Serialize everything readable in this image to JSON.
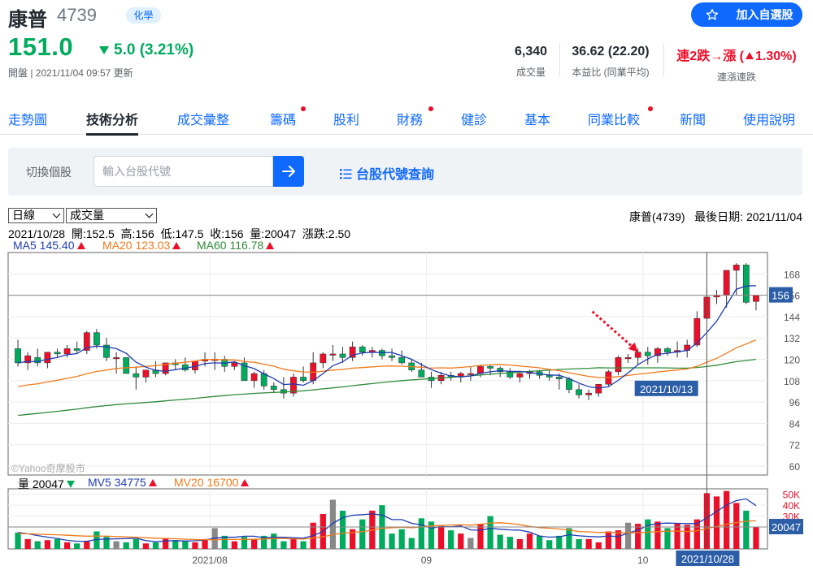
{
  "header": {
    "name": "康普",
    "code": "4739",
    "industry": "化學",
    "watch_label": "加入自選股",
    "price": "151.0",
    "change": "5.0 (3.21%)",
    "market_time": "開盤 | 2021/11/04 09:57 更新",
    "stats": {
      "volume_value": "6,340",
      "volume_label": "成交量",
      "pe_value": "36.62 (22.20)",
      "pe_label": "本益比 (同業平均)",
      "streak_value_pre": "連2跌→漲 (",
      "streak_value_pct": "1.30%)",
      "streak_label": "連漲連跌"
    },
    "colors": {
      "up": "#eb0f29",
      "down": "#00ab5e",
      "accent": "#0f69ff"
    }
  },
  "tabs": [
    {
      "label": "走勢圖",
      "active": false,
      "dot": false
    },
    {
      "label": "技術分析",
      "active": true,
      "dot": false
    },
    {
      "label": "成交彙整",
      "active": false,
      "dot": false
    },
    {
      "label": "籌碼",
      "active": false,
      "dot": true
    },
    {
      "label": "股利",
      "active": false,
      "dot": false
    },
    {
      "label": "財務",
      "active": false,
      "dot": true
    },
    {
      "label": "健診",
      "active": false,
      "dot": false
    },
    {
      "label": "基本",
      "active": false,
      "dot": false
    },
    {
      "label": "同業比較",
      "active": false,
      "dot": true
    },
    {
      "label": "新聞",
      "active": false,
      "dot": false
    },
    {
      "label": "使用說明",
      "active": false,
      "dot": false
    }
  ],
  "switch": {
    "label": "切換個股",
    "placeholder": "輸入台股代號",
    "lookup": "台股代號查詢"
  },
  "controls": {
    "period": "日線",
    "indicator": "成交量",
    "meta": "康普(4739)   最後日期: 2021/11/04",
    "ohlc": "2021/10/28  開:152.5  高:156  低:147.5  收:156  量:20047  漲跌:2.50",
    "ma5": "MA5 145.40",
    "ma20": "MA20 123.03",
    "ma60": "MA60 116.78",
    "vol": "量 20047",
    "mv5": "MV5 34775",
    "mv20": "MV20 16700"
  },
  "chart_data": {
    "type": "candlestick",
    "price_ticks": [
      "168",
      "156",
      "144",
      "132",
      "120",
      "108",
      "96",
      "84",
      "72",
      "60"
    ],
    "volume_ticks": [
      "50K",
      "40K",
      "30K",
      "20K"
    ],
    "x_labels": [
      "2021/08",
      "09",
      "10"
    ],
    "current_price_label": "156",
    "current_volume_label": "20047",
    "annotation_date": "2021/10/13",
    "crosshair_date": "2021/10/28",
    "watermark": "©Yahoo奇摩股市",
    "ylim": [
      55,
      180
    ],
    "vol_ylim": [
      0,
      55000
    ],
    "candles": [
      [
        126,
        131,
        116,
        118
      ],
      [
        118,
        124,
        114,
        122
      ],
      [
        121,
        126,
        116,
        118
      ],
      [
        118,
        124,
        115,
        124
      ],
      [
        124,
        126,
        121,
        123
      ],
      [
        123,
        128,
        121,
        126
      ],
      [
        126,
        130,
        123,
        125
      ],
      [
        125,
        136,
        123,
        135
      ],
      [
        135,
        137,
        126,
        128
      ],
      [
        128,
        132,
        119,
        121
      ],
      [
        121,
        124,
        112,
        121
      ],
      [
        121,
        121,
        114,
        112
      ],
      [
        112,
        116,
        103,
        110
      ],
      [
        110,
        114,
        107,
        114
      ],
      [
        114,
        119,
        110,
        112
      ],
      [
        112,
        118,
        111,
        118
      ],
      [
        118,
        120,
        114,
        117
      ],
      [
        117,
        121,
        113,
        114
      ],
      [
        114,
        119,
        112,
        119
      ],
      [
        119,
        124,
        116,
        120
      ],
      [
        120,
        124,
        114,
        120
      ],
      [
        120,
        122,
        113,
        116
      ],
      [
        116,
        119,
        114,
        118
      ],
      [
        118,
        121,
        113,
        108
      ],
      [
        108,
        113,
        104,
        112
      ],
      [
        112,
        114,
        103,
        105
      ],
      [
        105,
        107,
        101,
        103
      ],
      [
        103,
        110,
        98,
        101
      ],
      [
        101,
        112,
        99,
        110
      ],
      [
        110,
        116,
        107,
        108
      ],
      [
        108,
        124,
        106,
        118
      ],
      [
        118,
        124,
        115,
        123
      ],
      [
        123,
        128,
        119,
        123
      ],
      [
        123,
        127,
        118,
        121
      ],
      [
        121,
        130,
        119,
        127
      ],
      [
        127,
        128,
        122,
        124
      ],
      [
        124,
        127,
        121,
        125
      ],
      [
        125,
        126,
        120,
        122
      ],
      [
        122,
        126,
        119,
        121
      ],
      [
        121,
        125,
        117,
        118
      ],
      [
        118,
        120,
        113,
        114
      ],
      [
        114,
        118,
        110,
        110
      ],
      [
        110,
        113,
        104,
        108
      ],
      [
        108,
        113,
        106,
        111
      ],
      [
        111,
        113,
        108,
        110
      ],
      [
        110,
        113,
        107,
        112
      ],
      [
        112,
        116,
        108,
        112
      ],
      [
        112,
        117,
        110,
        116
      ],
      [
        116,
        117,
        111,
        115
      ],
      [
        115,
        116,
        110,
        113
      ],
      [
        113,
        115,
        109,
        110
      ],
      [
        110,
        113,
        107,
        112
      ],
      [
        112,
        114,
        109,
        113
      ],
      [
        113,
        114,
        109,
        111
      ],
      [
        111,
        114,
        108,
        110
      ],
      [
        110,
        112,
        103,
        109
      ],
      [
        109,
        110,
        101,
        103
      ],
      [
        103,
        106,
        98,
        100
      ],
      [
        100,
        103,
        97,
        101
      ],
      [
        101,
        106,
        99,
        106
      ],
      [
        106,
        114,
        105,
        113
      ],
      [
        113,
        122,
        111,
        121
      ],
      [
        121,
        123,
        118,
        121
      ],
      [
        121,
        126,
        117,
        124
      ],
      [
        124,
        127,
        117,
        122
      ],
      [
        122,
        127,
        118,
        126
      ],
      [
        126,
        127,
        122,
        124
      ],
      [
        124,
        130,
        121,
        125
      ],
      [
        125,
        131,
        121,
        128
      ],
      [
        128,
        147,
        127,
        143
      ],
      [
        143,
        160,
        142,
        155
      ],
      [
        155,
        159,
        151,
        156
      ],
      [
        156,
        170,
        149,
        170
      ],
      [
        170,
        174,
        156,
        173
      ],
      [
        173,
        174,
        151,
        152
      ],
      [
        152.5,
        156,
        147.5,
        156
      ]
    ],
    "volumes": [
      15,
      9,
      7,
      8,
      9,
      6,
      5,
      7,
      16,
      11,
      7,
      6,
      9,
      5,
      6,
      10,
      8,
      7,
      6,
      9,
      19,
      12,
      7,
      11,
      9,
      12,
      14,
      7,
      9,
      7,
      24,
      32,
      45,
      35,
      18,
      27,
      35,
      40,
      14,
      18,
      10,
      28,
      25,
      21,
      17,
      14,
      10,
      23,
      30,
      13,
      11,
      9,
      14,
      12,
      8,
      12,
      19,
      9,
      9,
      6,
      16,
      17,
      24,
      23,
      27,
      25,
      19,
      23,
      22,
      27,
      51,
      48,
      53,
      42,
      35,
      20
    ]
  }
}
